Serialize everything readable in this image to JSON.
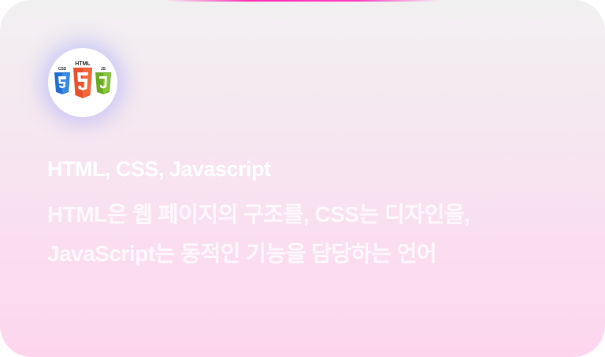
{
  "card": {
    "logo": {
      "icon": "html-css-js-logo-icon",
      "labels": {
        "css": "CSS",
        "html": "HTML",
        "js": "JS"
      },
      "colors": {
        "css": "#1f6fce",
        "html": "#e8502b",
        "js": "#7bbd2b"
      }
    },
    "title": "HTML, CSS, Javascript",
    "description_lines": [
      "HTML은 웹 페이지의 구조를, CSS는 디자인을,",
      "JavaScript는 동적인 기능을 담당하는 언어"
    ]
  }
}
